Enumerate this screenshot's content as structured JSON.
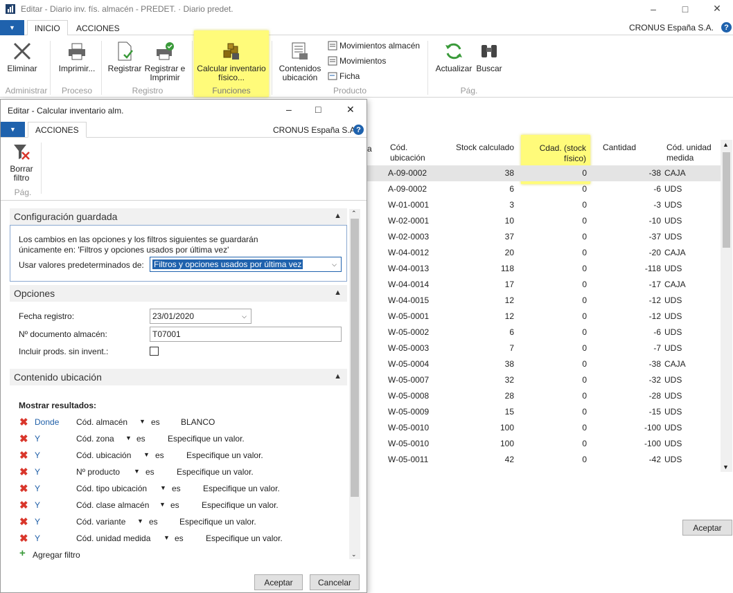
{
  "window": {
    "title": "Editar - Diario inv. fís. almacén - PREDET. · Diario predet."
  },
  "tabs": [
    {
      "label": "INICIO"
    },
    {
      "label": "ACCIONES"
    }
  ],
  "company": "CRONUS España S.A.",
  "help": "?",
  "ribbon": {
    "eliminar": "Eliminar",
    "imprimir": "Imprimir...",
    "registrar": "Registrar",
    "registrar_imprimir": "Registrar e Imprimir",
    "calcular_inv": "Calcular inventario físico...",
    "contenidos_ubicacion": "Contenidos ubicación",
    "mov_almacen": "Movimientos almacén",
    "movimientos": "Movimientos",
    "ficha": "Ficha",
    "actualizar": "Actualizar",
    "buscar": "Buscar",
    "groups": {
      "administrar": "Administrar",
      "proceso": "Proceso",
      "registro": "Registro",
      "funciones": "Funciones",
      "producto": "Producto",
      "pag": "Pág."
    }
  },
  "grid": {
    "headers": {
      "cod_ubicacion": "Cód. ubicación",
      "stock_calc": "Stock calculado",
      "cdad_stock": "Cdad. (stock físico)",
      "cantidad": "Cantidad",
      "cod_unidad": "Cód. unidad medida",
      "partial": "a"
    },
    "rows": [
      {
        "ubic": "A-09-0002",
        "stock": "38",
        "fisico": "0",
        "cant": "-38",
        "ud": "CAJA"
      },
      {
        "ubic": "A-09-0002",
        "stock": "6",
        "fisico": "0",
        "cant": "-6",
        "ud": "UDS"
      },
      {
        "ubic": "W-01-0001",
        "stock": "3",
        "fisico": "0",
        "cant": "-3",
        "ud": "UDS"
      },
      {
        "ubic": "W-02-0001",
        "stock": "10",
        "fisico": "0",
        "cant": "-10",
        "ud": "UDS"
      },
      {
        "ubic": "W-02-0003",
        "stock": "37",
        "fisico": "0",
        "cant": "-37",
        "ud": "UDS"
      },
      {
        "ubic": "W-04-0012",
        "stock": "20",
        "fisico": "0",
        "cant": "-20",
        "ud": "CAJA"
      },
      {
        "ubic": "W-04-0013",
        "stock": "118",
        "fisico": "0",
        "cant": "-118",
        "ud": "UDS"
      },
      {
        "ubic": "W-04-0014",
        "stock": "17",
        "fisico": "0",
        "cant": "-17",
        "ud": "CAJA"
      },
      {
        "ubic": "W-04-0015",
        "stock": "12",
        "fisico": "0",
        "cant": "-12",
        "ud": "UDS"
      },
      {
        "ubic": "W-05-0001",
        "stock": "12",
        "fisico": "0",
        "cant": "-12",
        "ud": "UDS"
      },
      {
        "ubic": "W-05-0002",
        "stock": "6",
        "fisico": "0",
        "cant": "-6",
        "ud": "UDS"
      },
      {
        "ubic": "W-05-0003",
        "stock": "7",
        "fisico": "0",
        "cant": "-7",
        "ud": "UDS"
      },
      {
        "ubic": "W-05-0004",
        "stock": "38",
        "fisico": "0",
        "cant": "-38",
        "ud": "CAJA"
      },
      {
        "ubic": "W-05-0007",
        "stock": "32",
        "fisico": "0",
        "cant": "-32",
        "ud": "UDS"
      },
      {
        "ubic": "W-05-0008",
        "stock": "28",
        "fisico": "0",
        "cant": "-28",
        "ud": "UDS"
      },
      {
        "ubic": "W-05-0009",
        "stock": "15",
        "fisico": "0",
        "cant": "-15",
        "ud": "UDS"
      },
      {
        "ubic": "W-05-0010",
        "stock": "100",
        "fisico": "0",
        "cant": "-100",
        "ud": "UDS"
      },
      {
        "ubic": "W-05-0010",
        "stock": "100",
        "fisico": "0",
        "cant": "-100",
        "ud": "UDS"
      },
      {
        "ubic": "W-05-0011",
        "stock": "42",
        "fisico": "0",
        "cant": "-42",
        "ud": "UDS"
      }
    ]
  },
  "main_ok": "Aceptar",
  "dialog": {
    "title": "Editar - Calcular inventario alm.",
    "tab": "ACCIONES",
    "company": "CRONUS España S.A.",
    "borrar_filtro": "Borrar filtro",
    "pag": "Pág.",
    "config": {
      "header": "Configuración guardada",
      "note1": "Los cambios en las opciones y los filtros siguientes se guardarán",
      "note2": "únicamente en: 'Filtros y opciones usados por última vez'",
      "usar_label": "Usar valores predeterminados de:",
      "usar_value": "Filtros y opciones usados por última vez"
    },
    "opciones": {
      "header": "Opciones",
      "fecha_label": "Fecha registro:",
      "fecha_value": "23/01/2020",
      "doc_label": "Nº documento almacén:",
      "doc_value": "T07001",
      "incluir_label": "Incluir prods. sin invent.:"
    },
    "contenido": {
      "header": "Contenido ubicación",
      "mostrar": "Mostrar resultados:",
      "filters": [
        {
          "op": "Donde",
          "field": "Cód. almacén",
          "es": "es",
          "value": "BLANCO"
        },
        {
          "op": "Y",
          "field": "Cód. zona",
          "es": "es",
          "value": "Especifique un valor."
        },
        {
          "op": "Y",
          "field": "Cód. ubicación",
          "es": "es",
          "value": "Especifique un valor."
        },
        {
          "op": "Y",
          "field": "Nº producto",
          "es": "es",
          "value": "Especifique un valor."
        },
        {
          "op": "Y",
          "field": "Cód. tipo ubicación",
          "es": "es",
          "value": "Especifique un valor."
        },
        {
          "op": "Y",
          "field": "Cód. clase almacén",
          "es": "es",
          "value": "Especifique un valor."
        },
        {
          "op": "Y",
          "field": "Cód. variante",
          "es": "es",
          "value": "Especifique un valor."
        },
        {
          "op": "Y",
          "field": "Cód. unidad medida",
          "es": "es",
          "value": "Especifique un valor."
        }
      ],
      "agregar": "Agregar filtro"
    },
    "aceptar": "Aceptar",
    "cancelar": "Cancelar"
  },
  "colors": {
    "accent": "#1f62ad",
    "highlight": "#fffb7a",
    "delete": "#d9362b"
  }
}
